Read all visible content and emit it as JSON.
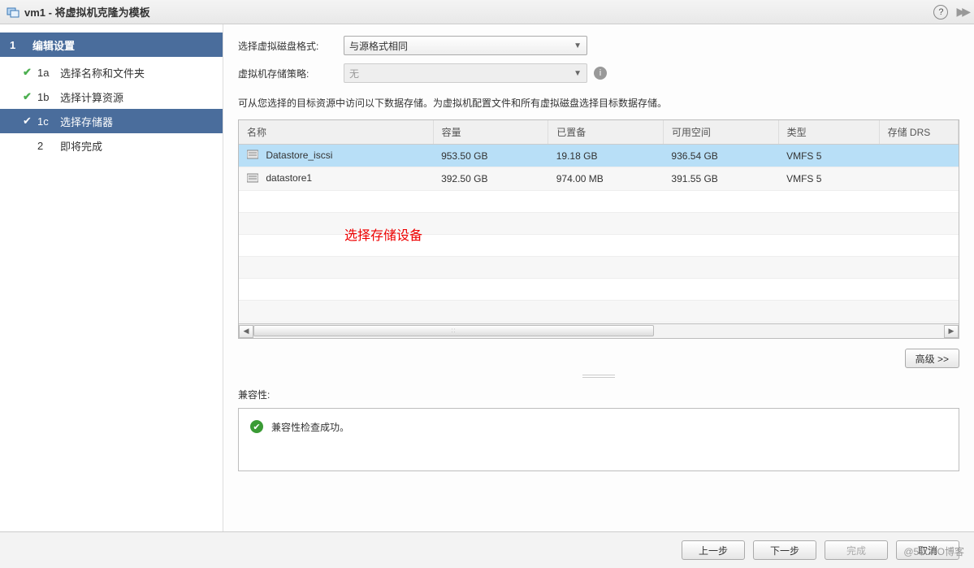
{
  "window": {
    "title": "vm1 - 将虚拟机克隆为模板"
  },
  "sidebar": {
    "items": [
      {
        "idx": "1",
        "label": "编辑设置",
        "kind": "group"
      },
      {
        "idx": "1a",
        "label": "选择名称和文件夹",
        "kind": "done"
      },
      {
        "idx": "1b",
        "label": "选择计算资源",
        "kind": "done"
      },
      {
        "idx": "1c",
        "label": "选择存储器",
        "kind": "current"
      },
      {
        "idx": "2",
        "label": "即将完成",
        "kind": "pending"
      }
    ]
  },
  "form": {
    "disk_format_label": "选择虚拟磁盘格式:",
    "disk_format_value": "与源格式相同",
    "storage_policy_label": "虚拟机存储策略:",
    "storage_policy_value": "无",
    "description": "可从您选择的目标资源中访问以下数据存储。为虚拟机配置文件和所有虚拟磁盘选择目标数据存储。"
  },
  "table": {
    "columns": [
      "名称",
      "容量",
      "已置备",
      "可用空间",
      "类型",
      "存储 DRS"
    ],
    "rows": [
      {
        "name": "Datastore_iscsi",
        "capacity": "953.50 GB",
        "provisioned": "19.18 GB",
        "free": "936.54 GB",
        "type": "VMFS 5",
        "drs": "",
        "selected": true
      },
      {
        "name": "datastore1",
        "capacity": "392.50 GB",
        "provisioned": "974.00 MB",
        "free": "391.55 GB",
        "type": "VMFS 5",
        "drs": "",
        "selected": false
      }
    ],
    "overlay": "选择存储设备"
  },
  "buttons": {
    "advanced": "高级 >>",
    "back": "上一步",
    "next": "下一步",
    "finish": "完成",
    "cancel": "取消"
  },
  "compat": {
    "label": "兼容性:",
    "message": "兼容性检查成功。"
  },
  "watermark": "@51CTO博客"
}
